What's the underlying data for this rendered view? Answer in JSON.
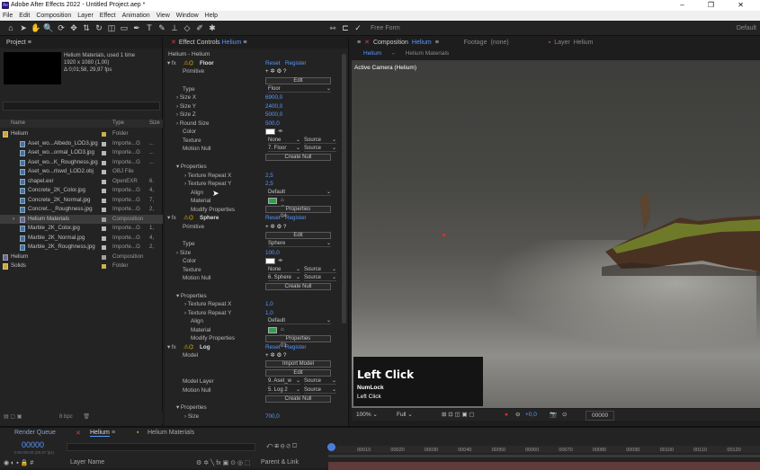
{
  "window": {
    "title": "Adobe After Effects 2022 - Untitled Project.aep *",
    "app_badge": "Ae",
    "controls": "– ❐ ✕"
  },
  "menu": [
    "File",
    "Edit",
    "Composition",
    "Layer",
    "Effect",
    "Animation",
    "View",
    "Window",
    "Help"
  ],
  "toolbar": {
    "free_form": "Free Form",
    "workspace": "Default"
  },
  "project": {
    "title": "Project",
    "selected_name": "Helium Materials",
    "used": ", used 1 time",
    "res": "1920 x 1080 (1,00)",
    "dur": "Δ 0;01;58, 29,97 fps",
    "col_name": "Name",
    "col_type": "Type",
    "col_size": "Size",
    "rows": [
      {
        "name": "Helium",
        "type": "Folder",
        "size": "",
        "color": "#c9b34a",
        "indent": 0,
        "kind": "folder"
      },
      {
        "name": "Aset_wo...Albedo_LOD3.jpg",
        "type": "Importe...G",
        "size": "...",
        "color": "#b8b8b8",
        "indent": 1,
        "kind": "file"
      },
      {
        "name": "Aset_wo...ormal_LOD3.jpg",
        "type": "Importe...G",
        "size": "...",
        "color": "#b8b8b8",
        "indent": 1,
        "kind": "file"
      },
      {
        "name": "Aset_wo...K_Roughness.jpg",
        "type": "Importe...G",
        "size": "...",
        "color": "#b8b8b8",
        "indent": 1,
        "kind": "file"
      },
      {
        "name": "Aset_wo...rlswd_LOD2.obj",
        "type": "OBJ File",
        "size": "",
        "color": "#b8b8b8",
        "indent": 1,
        "kind": "file"
      },
      {
        "name": "chapel.exr",
        "type": "OpenEXR",
        "size": "6.",
        "color": "#b8b8b8",
        "indent": 1,
        "kind": "file"
      },
      {
        "name": "Concrete_2K_Color.jpg",
        "type": "Importe...G",
        "size": "4,",
        "color": "#b8b8b8",
        "indent": 1,
        "kind": "file"
      },
      {
        "name": "Concrete_2K_Normal.jpg",
        "type": "Importe...G",
        "size": "7,",
        "color": "#b8b8b8",
        "indent": 1,
        "kind": "file"
      },
      {
        "name": "Concret..._Roughness.jpg",
        "type": "Importe...G",
        "size": "2,",
        "color": "#b8b8b8",
        "indent": 1,
        "kind": "file"
      },
      {
        "name": "Helium Materials",
        "type": "Composition",
        "size": "",
        "color": "#a0a0a0",
        "indent": 1,
        "kind": "comp",
        "selected": true
      },
      {
        "name": "Marble_2K_Color.jpg",
        "type": "Importe...G",
        "size": "1,",
        "color": "#b8b8b8",
        "indent": 1,
        "kind": "file"
      },
      {
        "name": "Marble_2K_Normal.jpg",
        "type": "Importe...G",
        "size": "4,",
        "color": "#b8b8b8",
        "indent": 1,
        "kind": "file"
      },
      {
        "name": "Marble_2K_Roughness.jpg",
        "type": "Importe...G",
        "size": "2,",
        "color": "#b8b8b8",
        "indent": 1,
        "kind": "file"
      },
      {
        "name": "Helium",
        "type": "Composition",
        "size": "",
        "color": "#a0a0a0",
        "indent": 0,
        "kind": "comp"
      },
      {
        "name": "Solids",
        "type": "Folder",
        "size": "",
        "color": "#c9b34a",
        "indent": 0,
        "kind": "folder"
      }
    ],
    "bpc": "8 bpc"
  },
  "effect": {
    "title": "Effect Controls",
    "comp": "Helium",
    "sub": "Helium - Helium",
    "reset": "Reset",
    "register": "Register",
    "floor": {
      "name": "Floor",
      "primitive": "Primitive",
      "edit": "Edit",
      "type_lbl": "Type",
      "type": "Floor",
      "sizex_lbl": "Size X",
      "sizex": "6900,0",
      "sizey_lbl": "Size Y",
      "sizey": "2400,0",
      "sizez_lbl": "Size Z",
      "sizez": "5000,0",
      "round_lbl": "Round Size",
      "round": "500,0",
      "color_lbl": "Color",
      "texture_lbl": "Texture",
      "texture": "None",
      "source": "Source",
      "motion_lbl": "Motion Null",
      "motion": "7. Floor",
      "create_null": "Create Null",
      "props": "Properties",
      "trx_lbl": "Texture Repeat X",
      "trx": "2,5",
      "try_lbl": "Texture Repeat Y",
      "try": "2,5",
      "align_lbl": "Align",
      "align": "Default",
      "material_lbl": "Material",
      "material": "Concrete 04",
      "modify_lbl": "Modify Properties",
      "properties": "Properties"
    },
    "sphere": {
      "name": "Sphere",
      "primitive": "Primitive",
      "edit": "Edit",
      "type_lbl": "Type",
      "type": "Sphere",
      "size_lbl": "Size",
      "size": "100,0",
      "color_lbl": "Color",
      "texture_lbl": "Texture",
      "texture": "None",
      "source": "Source",
      "motion_lbl": "Motion Null",
      "motion": "6. Sphere",
      "create_null": "Create Null",
      "props": "Properties",
      "trx_lbl": "Texture Repeat X",
      "trx": "1,0",
      "try_lbl": "Texture Repeat Y",
      "try": "1,0",
      "align_lbl": "Align",
      "align": "Default",
      "material_lbl": "Material",
      "material": "Marble 01",
      "modify_lbl": "Modify Properties",
      "properties": "Properties"
    },
    "log": {
      "name": "Log",
      "model": "Model",
      "import": "Import Model",
      "edit": "Edit",
      "layer_lbl": "Model Layer",
      "layer": "9. Aset_w",
      "source": "Source",
      "motion_lbl": "Motion Null",
      "motion": "5. Log 2",
      "create_null": "Create Null",
      "props": "Properties",
      "size_lbl": "Size",
      "size": "700,0"
    }
  },
  "comp": {
    "title": "Composition",
    "comp": "Helium",
    "footage": "Footage",
    "footage_val": "(none)",
    "layer": "Layer",
    "layer_val": "Helium",
    "tab1": "Helium",
    "tab2": "Helium Materials",
    "camera": "Active Camera (Helium)",
    "zoom": "100%",
    "quality": "Full",
    "exposure": "+0,0",
    "timecode": "00000"
  },
  "overlay": {
    "action": "Left Click",
    "key": "NumLock",
    "detail": "Left Click"
  },
  "timeline": {
    "render_queue": "Render Queue",
    "tab1": "Helium",
    "tab2": "Helium Materials",
    "time": "00000",
    "time_sub": "0:00:00:00 (29.97 fps)",
    "layer_name": "Layer Name",
    "parent": "Parent & Link",
    "ticks": [
      "00010",
      "00020",
      "00030",
      "00040",
      "00050",
      "00060",
      "00070",
      "00080",
      "00090",
      "00100",
      "00110",
      "00120"
    ]
  }
}
